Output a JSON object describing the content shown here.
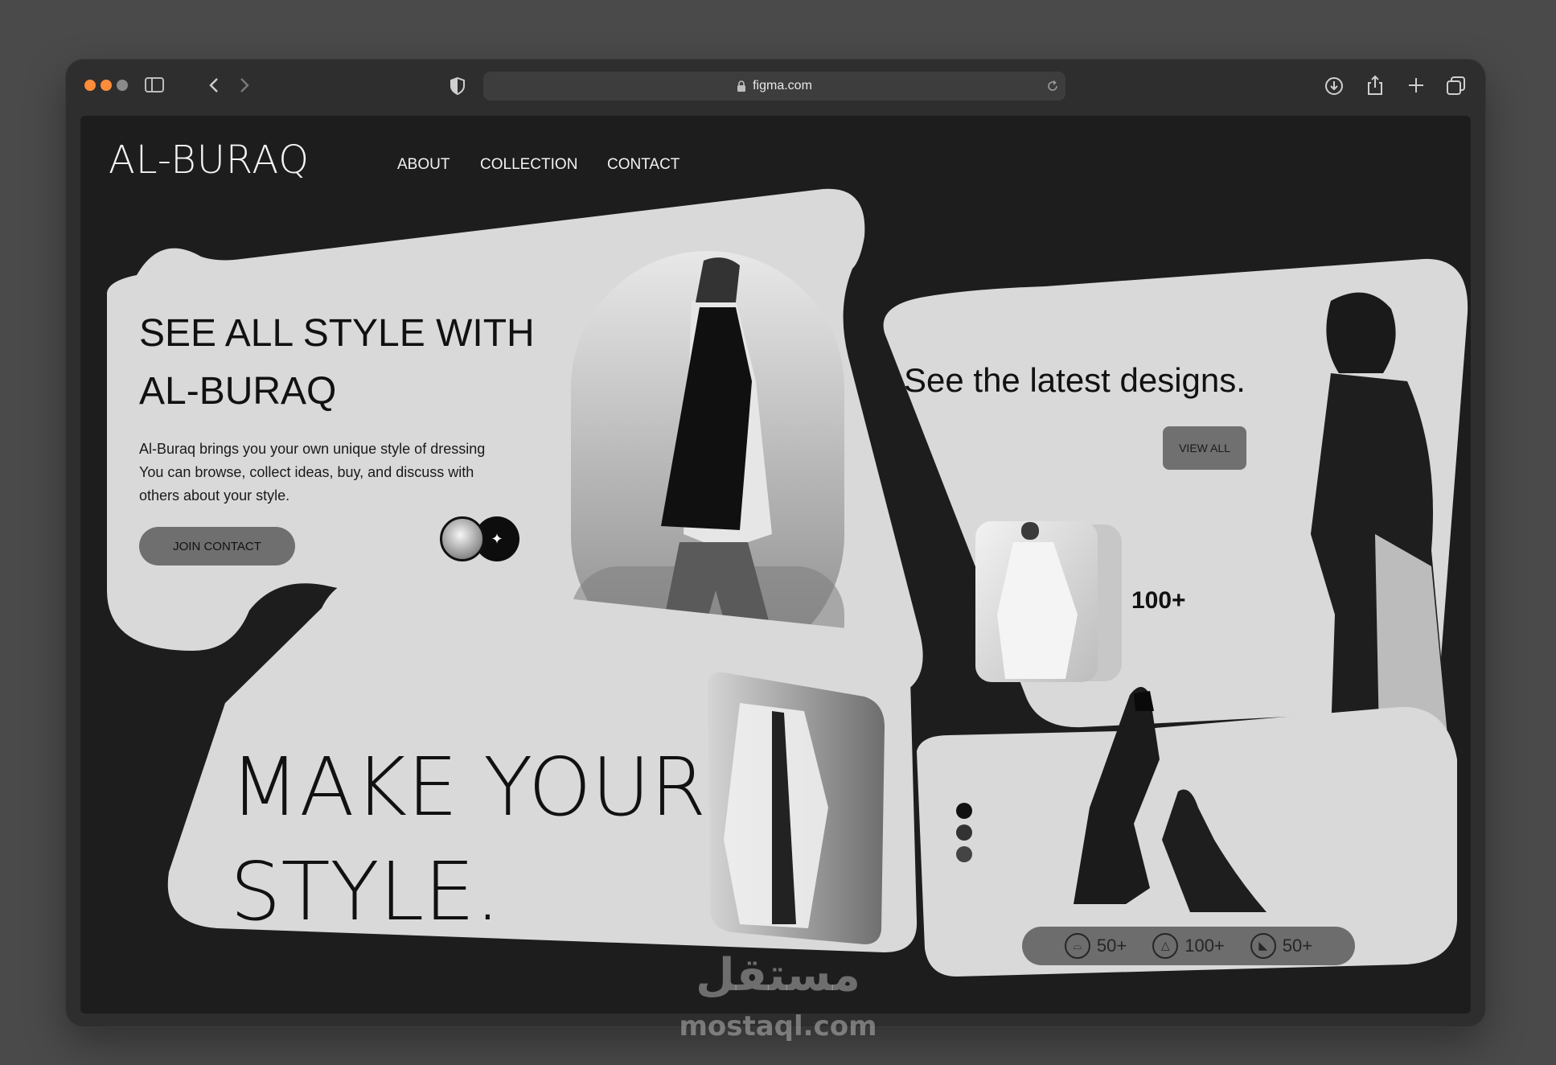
{
  "browser": {
    "url": "figma.com",
    "traffic_lights": [
      "#ff8c3a",
      "#ff8c3a",
      "#8a8a8a"
    ],
    "icons": {
      "sidebar": "sidebar-icon",
      "back": "chevron-left-icon",
      "forward": "chevron-right-icon",
      "shield": "shield-icon",
      "lock": "lock-icon",
      "reload": "reload-icon",
      "download": "download-icon",
      "share": "share-icon",
      "new_tab": "plus-icon",
      "tabs": "tabs-icon"
    }
  },
  "site": {
    "brand": "AL-BURAQ",
    "nav": [
      "ABOUT",
      "COLLECTION",
      "CONTACT"
    ]
  },
  "hero": {
    "title": "SEE ALL STYLE WITH AL-BURAQ",
    "description": "Al-Buraq brings you your own unique style of dressing\nYou can browse, collect ideas, buy, and discuss with\nothers about your style.",
    "button": "JOIN CONTACT"
  },
  "latest": {
    "title": "See the latest designs.",
    "button": "VIEW ALL",
    "count": "100+"
  },
  "style": {
    "title_line1": "MAKE YOUR",
    "title_line2": "STYLE."
  },
  "stats": [
    {
      "icon": "hat-icon",
      "value": "50+"
    },
    {
      "icon": "hanger-icon",
      "value": "100+"
    },
    {
      "icon": "shoe-icon",
      "value": "50+"
    }
  ],
  "watermark": {
    "arabic": "مستقل",
    "latin": "mostaql.com"
  },
  "colors": {
    "page_bg": "#1d1d1d",
    "card": "#d9d9d9",
    "button": "#6f6f6f",
    "text": "#111111"
  }
}
